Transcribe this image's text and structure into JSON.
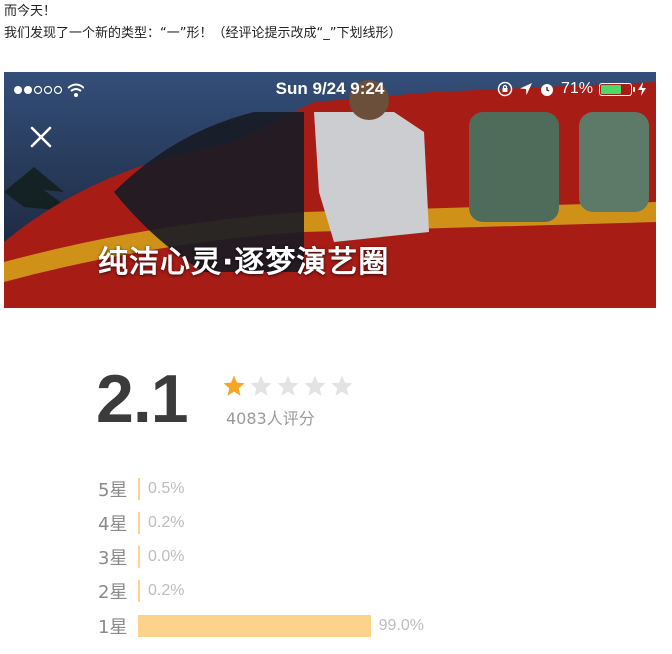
{
  "intro": {
    "line1": "而今天！",
    "line2": "我们发现了一个新的类型：“一”形！（经评论提示改成“_”下划线形）"
  },
  "status_bar": {
    "time": "Sun 9/24 9:24",
    "battery_percent": "71%",
    "battery_level": 0.71,
    "icons": [
      "signal-dots-icon",
      "wifi-icon",
      "orientation-lock-icon",
      "location-arrow-icon",
      "alarm-icon",
      "battery-icon",
      "charging-bolt-icon"
    ]
  },
  "hero": {
    "title": "纯洁心灵·逐梦演艺圈",
    "close_icon": "close-icon"
  },
  "rating": {
    "score": "2.1",
    "stars_filled": 1,
    "stars_total": 5,
    "count_label": "4083人评分",
    "star_color": "#f6a623",
    "star_empty_color": "#e3e3e3",
    "bar_color": "#fdd28a",
    "distribution": [
      {
        "label": "5星",
        "percent": "0.5%",
        "value": 0.5
      },
      {
        "label": "4星",
        "percent": "0.2%",
        "value": 0.2
      },
      {
        "label": "3星",
        "percent": "0.0%",
        "value": 0.0
      },
      {
        "label": "2星",
        "percent": "0.2%",
        "value": 0.2
      },
      {
        "label": "1星",
        "percent": "99.0%",
        "value": 99.0
      }
    ]
  }
}
